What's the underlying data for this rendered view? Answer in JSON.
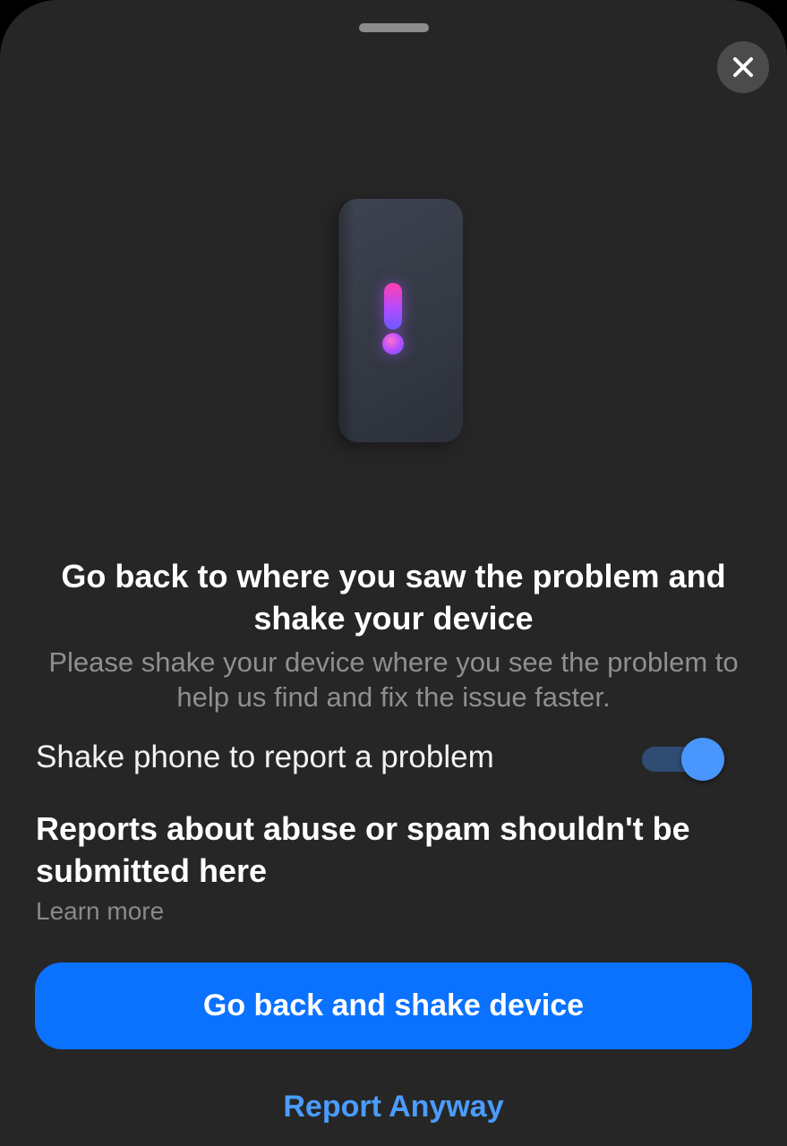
{
  "sheet": {
    "grabber_icon": "drag-handle",
    "close_icon": "close-x"
  },
  "illustration": {
    "icon": "phone-exclamation-illustration"
  },
  "content": {
    "title": "Go back to where you saw the problem and shake your device",
    "subtitle": "Please shake your device where you see the problem to help us find and fix the issue faster."
  },
  "shake_toggle": {
    "label": "Shake phone to report a problem",
    "enabled": true
  },
  "notice": {
    "text": "Reports about abuse or spam shouldn't be submitted here",
    "link": "Learn more"
  },
  "actions": {
    "primary_label": "Go back and shake device",
    "secondary_label": "Report Anyway"
  },
  "colors": {
    "background": "#262626",
    "primary": "#0a72ff",
    "link": "#4a9cff",
    "toggle_knob": "#4a96ff",
    "toggle_track": "#2f4c72"
  }
}
